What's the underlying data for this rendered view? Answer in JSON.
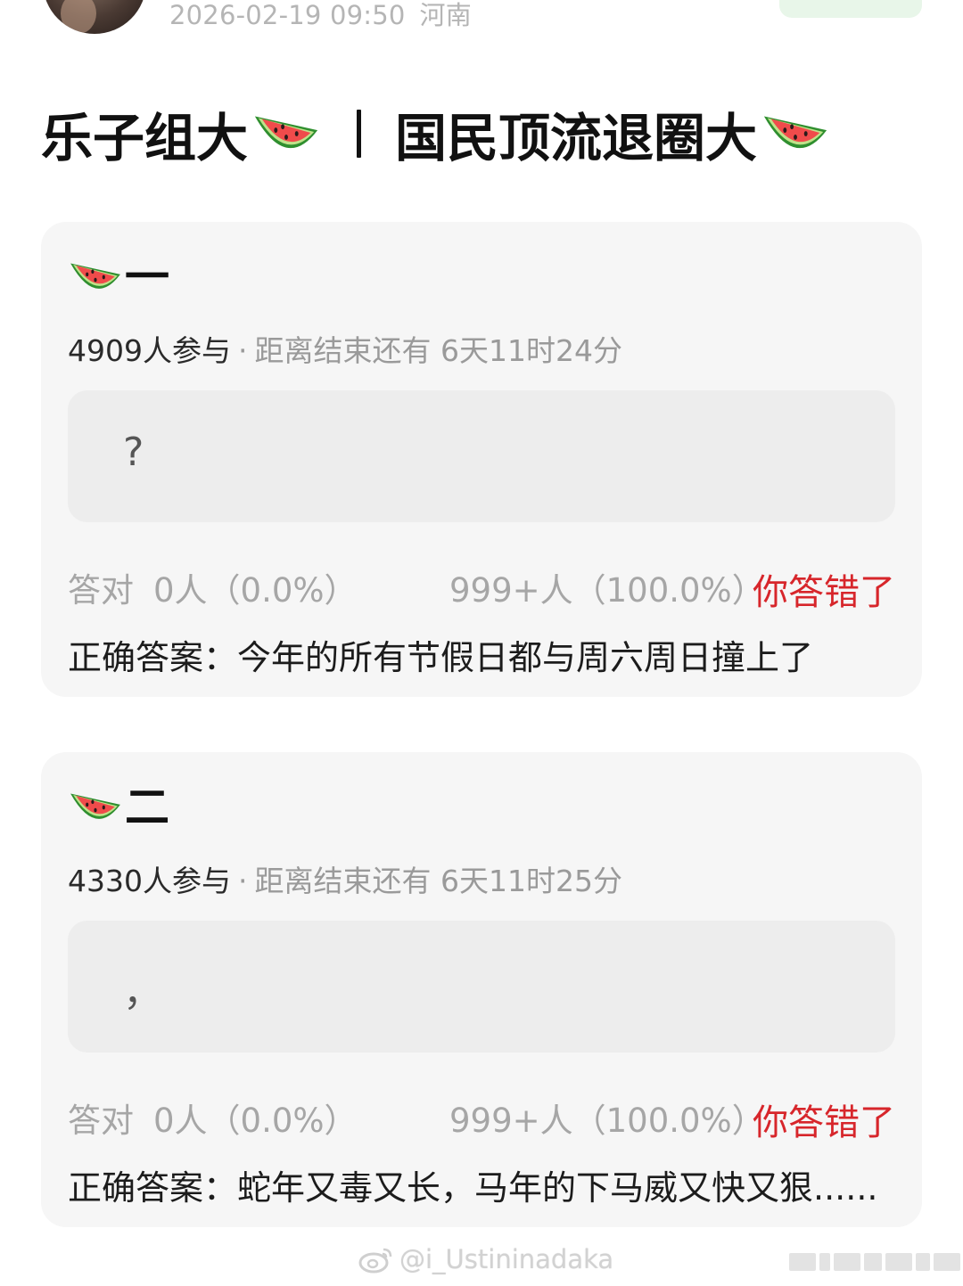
{
  "header": {
    "timestamp": "2026-02-19 09:50",
    "location": "河南"
  },
  "post": {
    "title_left": "乐子组大",
    "title_right": "国民顶流退圈大"
  },
  "cards": [
    {
      "number": "一",
      "participants": "4909人参与",
      "countdown": "距离结束还有 6天11时24分",
      "answer_text": "?",
      "correct_label": "答对",
      "correct_count": "0人（0.0%）",
      "wrong_count": "999+人（100.0%）",
      "status": "你答错了",
      "correct_answer_label": "正确答案：",
      "correct_answer": "今年的所有节假日都与周六周日撞上了"
    },
    {
      "number": "二",
      "participants": "4330人参与",
      "countdown": "距离结束还有 6天11时25分",
      "answer_text": "，",
      "correct_label": "答对",
      "correct_count": "0人（0.0%）",
      "wrong_count": "999+人（100.0%）",
      "status": "你答错了",
      "correct_answer_label": "正确答案：",
      "correct_answer": "蛇年又毒又长，马年的下马威又快又狠......"
    }
  ],
  "watermark": {
    "handle": "@i_Ustininadaka"
  },
  "colors": {
    "status_red": "#d7262b",
    "card_bg": "#f6f6f6",
    "answer_box_bg": "#ededed"
  },
  "icons": [
    "watermelon-icon",
    "weibo-icon"
  ]
}
